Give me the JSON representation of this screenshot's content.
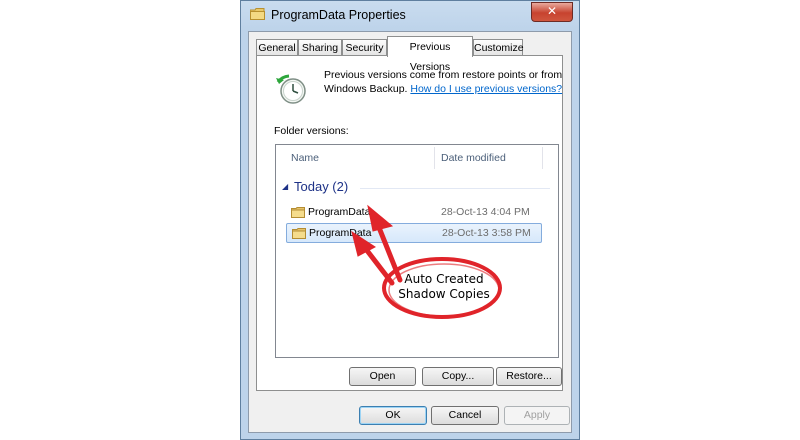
{
  "window": {
    "title": "ProgramData Properties",
    "close_glyph": "✕"
  },
  "tabs": [
    {
      "label": "General"
    },
    {
      "label": "Sharing"
    },
    {
      "label": "Security"
    },
    {
      "label": "Previous Versions",
      "active": true
    },
    {
      "label": "Customize"
    }
  ],
  "info": {
    "text": "Previous versions come from restore points or from Windows Backup.",
    "link": "How do I use previous versions?"
  },
  "folder_versions": {
    "label": "Folder versions:",
    "columns": {
      "name": "Name",
      "date": "Date modified"
    },
    "group": {
      "label": "Today (2)",
      "expanded": true
    },
    "rows": [
      {
        "name": "ProgramData",
        "date": "28-Oct-13 4:04 PM",
        "selected": false
      },
      {
        "name": "ProgramData",
        "date": "28-Oct-13 3:58 PM",
        "selected": true
      }
    ]
  },
  "panel_buttons": {
    "open": "Open",
    "copy": "Copy...",
    "restore": "Restore..."
  },
  "dialog_buttons": {
    "ok": "OK",
    "cancel": "Cancel",
    "apply": "Apply"
  },
  "annotation": {
    "callout_line1": "Auto Created",
    "callout_line2": "Shadow Copies",
    "color": "#e0242a"
  },
  "icons": {
    "title": "folder-icon",
    "restore": "restore-clock-icon",
    "rows": "folder-icon"
  }
}
